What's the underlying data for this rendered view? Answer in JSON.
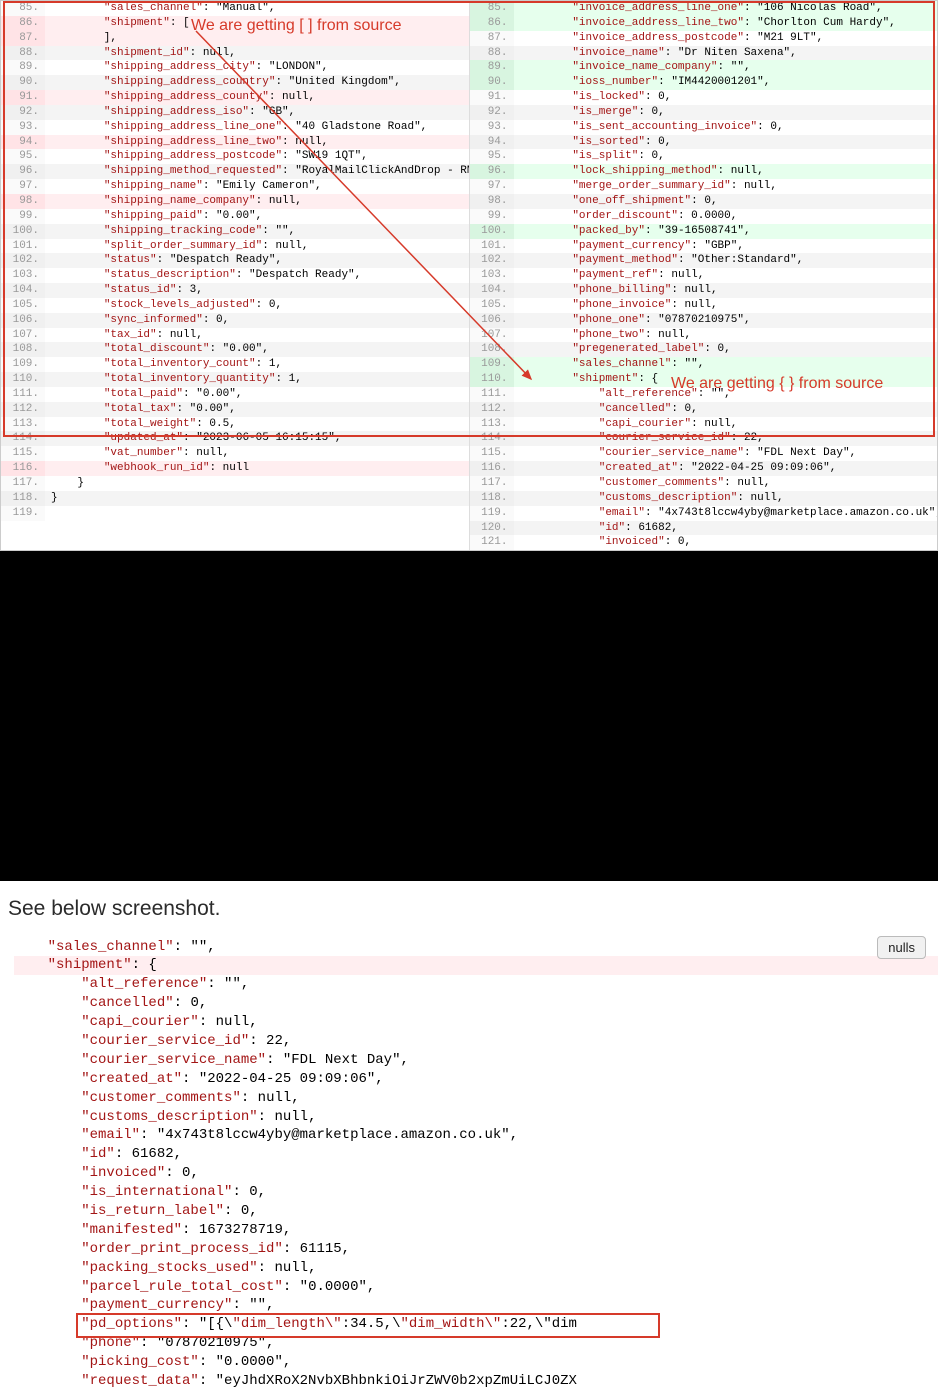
{
  "diff": {
    "annotations": {
      "left_label": "We are getting [ ] from source",
      "right_label": "We are getting { } from source"
    },
    "left": [
      {
        "n": 85,
        "cls": "",
        "t": "        \"sales_channel\": \"Manual\","
      },
      {
        "n": 86,
        "cls": "del",
        "t": "        \"shipment\": ["
      },
      {
        "n": 87,
        "cls": "del",
        "t": "        ],"
      },
      {
        "n": 88,
        "cls": "alt",
        "t": "        \"shipment_id\": null,"
      },
      {
        "n": 89,
        "cls": "",
        "t": "        \"shipping_address_city\": \"LONDON\","
      },
      {
        "n": 90,
        "cls": "alt",
        "t": "        \"shipping_address_country\": \"United Kingdom\","
      },
      {
        "n": 91,
        "cls": "del",
        "t": "        \"shipping_address_county\": null,"
      },
      {
        "n": 92,
        "cls": "alt",
        "t": "        \"shipping_address_iso\": \"GB\","
      },
      {
        "n": 93,
        "cls": "",
        "t": "        \"shipping_address_line_one\": \"40 Gladstone Road\","
      },
      {
        "n": 94,
        "cls": "del",
        "t": "        \"shipping_address_line_two\": null,"
      },
      {
        "n": 95,
        "cls": "",
        "t": "        \"shipping_address_postcode\": \"SW19 1QT\","
      },
      {
        "n": 96,
        "cls": "alt",
        "t": "        \"shipping_method_requested\": \"RoyalMailClickAndDrop - RMCD Trac"
      },
      {
        "n": 97,
        "cls": "",
        "t": "        \"shipping_name\": \"Emily Cameron\","
      },
      {
        "n": 98,
        "cls": "del",
        "t": "        \"shipping_name_company\": null,"
      },
      {
        "n": 99,
        "cls": "",
        "t": "        \"shipping_paid\": \"0.00\","
      },
      {
        "n": 100,
        "cls": "alt",
        "t": "        \"shipping_tracking_code\": \"\","
      },
      {
        "n": 101,
        "cls": "",
        "t": "        \"split_order_summary_id\": null,"
      },
      {
        "n": 102,
        "cls": "alt",
        "t": "        \"status\": \"Despatch Ready\","
      },
      {
        "n": 103,
        "cls": "",
        "t": "        \"status_description\": \"Despatch Ready\","
      },
      {
        "n": 104,
        "cls": "alt",
        "t": "        \"status_id\": 3,"
      },
      {
        "n": 105,
        "cls": "",
        "t": "        \"stock_levels_adjusted\": 0,"
      },
      {
        "n": 106,
        "cls": "alt",
        "t": "        \"sync_informed\": 0,"
      },
      {
        "n": 107,
        "cls": "",
        "t": "        \"tax_id\": null,"
      },
      {
        "n": 108,
        "cls": "alt",
        "t": "        \"total_discount\": \"0.00\","
      },
      {
        "n": 109,
        "cls": "",
        "t": "        \"total_inventory_count\": 1,"
      },
      {
        "n": 110,
        "cls": "alt",
        "t": "        \"total_inventory_quantity\": 1,"
      },
      {
        "n": 111,
        "cls": "",
        "t": "        \"total_paid\": \"0.00\","
      },
      {
        "n": 112,
        "cls": "alt",
        "t": "        \"total_tax\": \"0.00\","
      },
      {
        "n": 113,
        "cls": "",
        "t": "        \"total_weight\": 0.5,"
      },
      {
        "n": 114,
        "cls": "alt",
        "t": "        \"updated_at\": \"2023-06-05 16:15:15\","
      },
      {
        "n": 115,
        "cls": "",
        "t": "        \"vat_number\": null,"
      },
      {
        "n": 116,
        "cls": "del",
        "t": "        \"webhook_run_id\": null"
      },
      {
        "n": 117,
        "cls": "",
        "t": "    }"
      },
      {
        "n": 118,
        "cls": "alt",
        "t": "}"
      },
      {
        "n": 119,
        "cls": "",
        "t": ""
      }
    ],
    "right": [
      {
        "n": 85,
        "cls": "add",
        "t": "        \"invoice_address_line_one\": \"106 Nicolas Road\","
      },
      {
        "n": 86,
        "cls": "add",
        "t": "        \"invoice_address_line_two\": \"Chorlton Cum Hardy\","
      },
      {
        "n": 87,
        "cls": "",
        "t": "        \"invoice_address_postcode\": \"M21 9LT\","
      },
      {
        "n": 88,
        "cls": "alt",
        "t": "        \"invoice_name\": \"Dr Niten Saxena\","
      },
      {
        "n": 89,
        "cls": "add",
        "t": "        \"invoice_name_company\": \"\","
      },
      {
        "n": 90,
        "cls": "add",
        "t": "        \"ioss_number\": \"IM4420001201\","
      },
      {
        "n": 91,
        "cls": "",
        "t": "        \"is_locked\": 0,"
      },
      {
        "n": 92,
        "cls": "alt",
        "t": "        \"is_merge\": 0,"
      },
      {
        "n": 93,
        "cls": "",
        "t": "        \"is_sent_accounting_invoice\": 0,"
      },
      {
        "n": 94,
        "cls": "alt",
        "t": "        \"is_sorted\": 0,"
      },
      {
        "n": 95,
        "cls": "",
        "t": "        \"is_split\": 0,"
      },
      {
        "n": 96,
        "cls": "add",
        "t": "        \"lock_shipping_method\": null,"
      },
      {
        "n": 97,
        "cls": "",
        "t": "        \"merge_order_summary_id\": null,"
      },
      {
        "n": 98,
        "cls": "alt",
        "t": "        \"one_off_shipment\": 0,"
      },
      {
        "n": 99,
        "cls": "",
        "t": "        \"order_discount\": 0.0000,"
      },
      {
        "n": 100,
        "cls": "add",
        "t": "        \"packed_by\": \"39-16508741\","
      },
      {
        "n": 101,
        "cls": "",
        "t": "        \"payment_currency\": \"GBP\","
      },
      {
        "n": 102,
        "cls": "alt",
        "t": "        \"payment_method\": \"Other:Standard\","
      },
      {
        "n": 103,
        "cls": "",
        "t": "        \"payment_ref\": null,"
      },
      {
        "n": 104,
        "cls": "alt",
        "t": "        \"phone_billing\": null,"
      },
      {
        "n": 105,
        "cls": "",
        "t": "        \"phone_invoice\": null,"
      },
      {
        "n": 106,
        "cls": "alt",
        "t": "        \"phone_one\": \"07870210975\","
      },
      {
        "n": 107,
        "cls": "",
        "t": "        \"phone_two\": null,"
      },
      {
        "n": 108,
        "cls": "alt",
        "t": "        \"pregenerated_label\": 0,"
      },
      {
        "n": 109,
        "cls": "add",
        "t": "        \"sales_channel\": \"\","
      },
      {
        "n": 110,
        "cls": "add",
        "t": "        \"shipment\": {"
      },
      {
        "n": 111,
        "cls": "",
        "t": "            \"alt_reference\": \"\","
      },
      {
        "n": 112,
        "cls": "alt",
        "t": "            \"cancelled\": 0,"
      },
      {
        "n": 113,
        "cls": "",
        "t": "            \"capi_courier\": null,"
      },
      {
        "n": 114,
        "cls": "alt",
        "t": "            \"courier_service_id\": 22,"
      },
      {
        "n": 115,
        "cls": "",
        "t": "            \"courier_service_name\": \"FDL Next Day\","
      },
      {
        "n": 116,
        "cls": "alt",
        "t": "            \"created_at\": \"2022-04-25 09:09:06\","
      },
      {
        "n": 117,
        "cls": "",
        "t": "            \"customer_comments\": null,"
      },
      {
        "n": 118,
        "cls": "alt",
        "t": "            \"customs_description\": null,"
      },
      {
        "n": 119,
        "cls": "",
        "t": "            \"email\": \"4x743t8lccw4yby@marketplace.amazon.co.uk\","
      },
      {
        "n": 120,
        "cls": "alt",
        "t": "            \"id\": 61682,"
      },
      {
        "n": 121,
        "cls": "",
        "t": "            \"invoiced\": 0,"
      }
    ]
  },
  "caption_text": "See below screenshot.",
  "nulls_button": "nulls",
  "shot2": {
    "lines": [
      {
        "cls": "",
        "t": "    \"sales_channel\": \"\","
      },
      {
        "cls": "hl",
        "t": "    \"shipment\": {"
      },
      {
        "cls": "",
        "t": "        \"alt_reference\": \"\","
      },
      {
        "cls": "",
        "t": "        \"cancelled\": 0,"
      },
      {
        "cls": "",
        "t": "        \"capi_courier\": null,"
      },
      {
        "cls": "",
        "t": "        \"courier_service_id\": 22,"
      },
      {
        "cls": "",
        "t": "        \"courier_service_name\": \"FDL Next Day\","
      },
      {
        "cls": "",
        "t": "        \"created_at\": \"2022-04-25 09:09:06\","
      },
      {
        "cls": "",
        "t": "        \"customer_comments\": null,"
      },
      {
        "cls": "",
        "t": "        \"customs_description\": null,"
      },
      {
        "cls": "",
        "t": "        \"email\": \"4x743t8lccw4yby@marketplace.amazon.co.uk\","
      },
      {
        "cls": "",
        "t": "        \"id\": 61682,"
      },
      {
        "cls": "",
        "t": "        \"invoiced\": 0,"
      },
      {
        "cls": "",
        "t": "        \"is_international\": 0,"
      },
      {
        "cls": "",
        "t": "        \"is_return_label\": 0,"
      },
      {
        "cls": "",
        "t": "        \"manifested\": 1673278719,"
      },
      {
        "cls": "",
        "t": "        \"order_print_process_id\": 61115,"
      },
      {
        "cls": "",
        "t": "        \"packing_stocks_used\": null,"
      },
      {
        "cls": "",
        "t": "        \"parcel_rule_total_cost\": \"0.0000\","
      },
      {
        "cls": "",
        "t": "        \"payment_currency\": \"\","
      },
      {
        "cls": "",
        "t": "        \"pd_options\": \"[{\\\"dim_length\\\":34.5,\\\"dim_width\\\":22,\\\"dim"
      },
      {
        "cls": "",
        "t": "        \"phone\": \"07870210975\","
      },
      {
        "cls": "",
        "t": "        \"picking_cost\": \"0.0000\","
      },
      {
        "cls": "",
        "t": "        \"request_data\": \"eyJhdXRoX2NvbXBhbnkiOiJrZWV0b2xpZmUiLCJ0ZX"
      }
    ]
  }
}
